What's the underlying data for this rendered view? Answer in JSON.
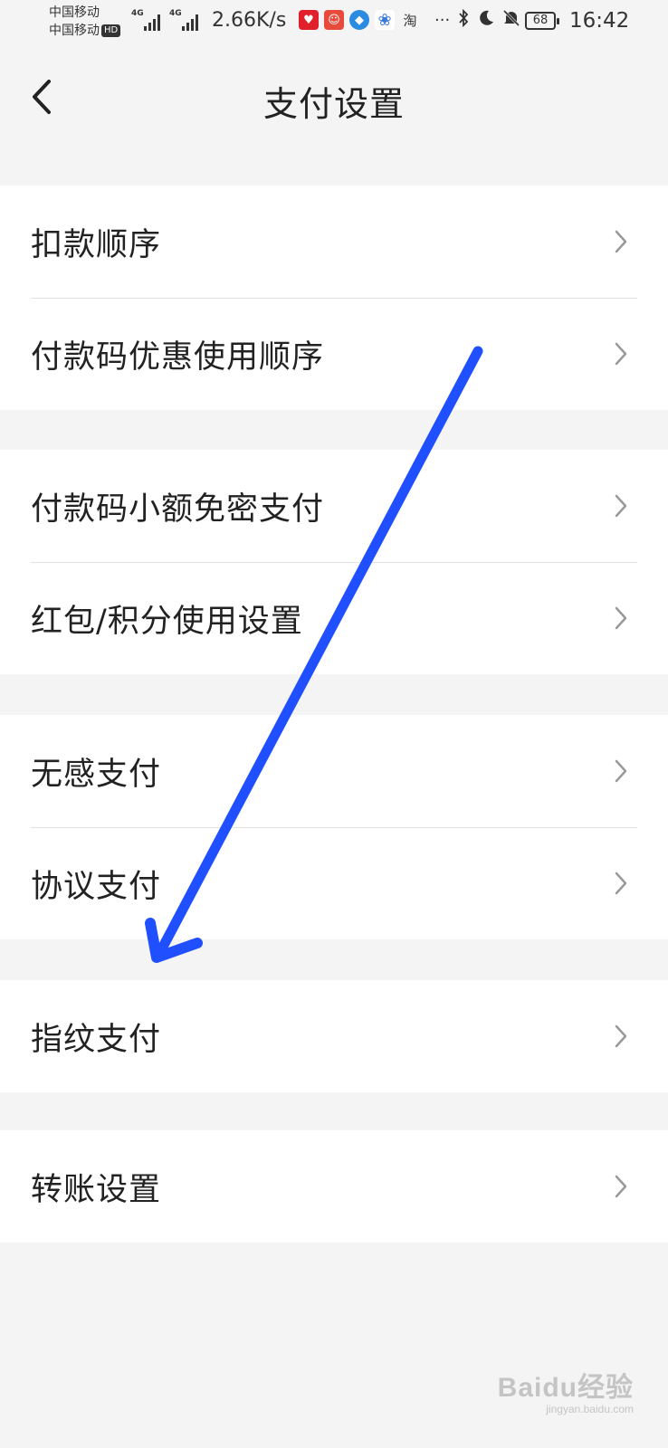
{
  "status_bar": {
    "carrier_1": "中国移动",
    "carrier_2": "中国移动",
    "hd_badge": "HD",
    "network_1": "4G",
    "network_2": "4G",
    "speed": "2.66K/s",
    "ellipsis": "···",
    "taobao_char": "淘",
    "battery": "68",
    "time": "16:42",
    "colors": {
      "app1": "#e0202a",
      "app2": "#e84b3c",
      "app3": "#2a8be0",
      "app4": "#3a7ad8"
    }
  },
  "header": {
    "title": "支付设置",
    "back_icon": "chevron-left-icon"
  },
  "groups": [
    {
      "items": [
        {
          "label": "扣款顺序"
        },
        {
          "label": "付款码优惠使用顺序"
        }
      ]
    },
    {
      "items": [
        {
          "label": "付款码小额免密支付"
        },
        {
          "label": "红包/积分使用设置"
        }
      ]
    },
    {
      "items": [
        {
          "label": "无感支付"
        },
        {
          "label": "协议支付"
        }
      ]
    },
    {
      "items": [
        {
          "label": "指纹支付"
        }
      ]
    },
    {
      "items": [
        {
          "label": "转账设置"
        }
      ]
    }
  ],
  "annotation": {
    "color": "#1f4fff"
  },
  "watermark": {
    "mark": "Baidu经验",
    "url": "jingyan.baidu.com"
  }
}
